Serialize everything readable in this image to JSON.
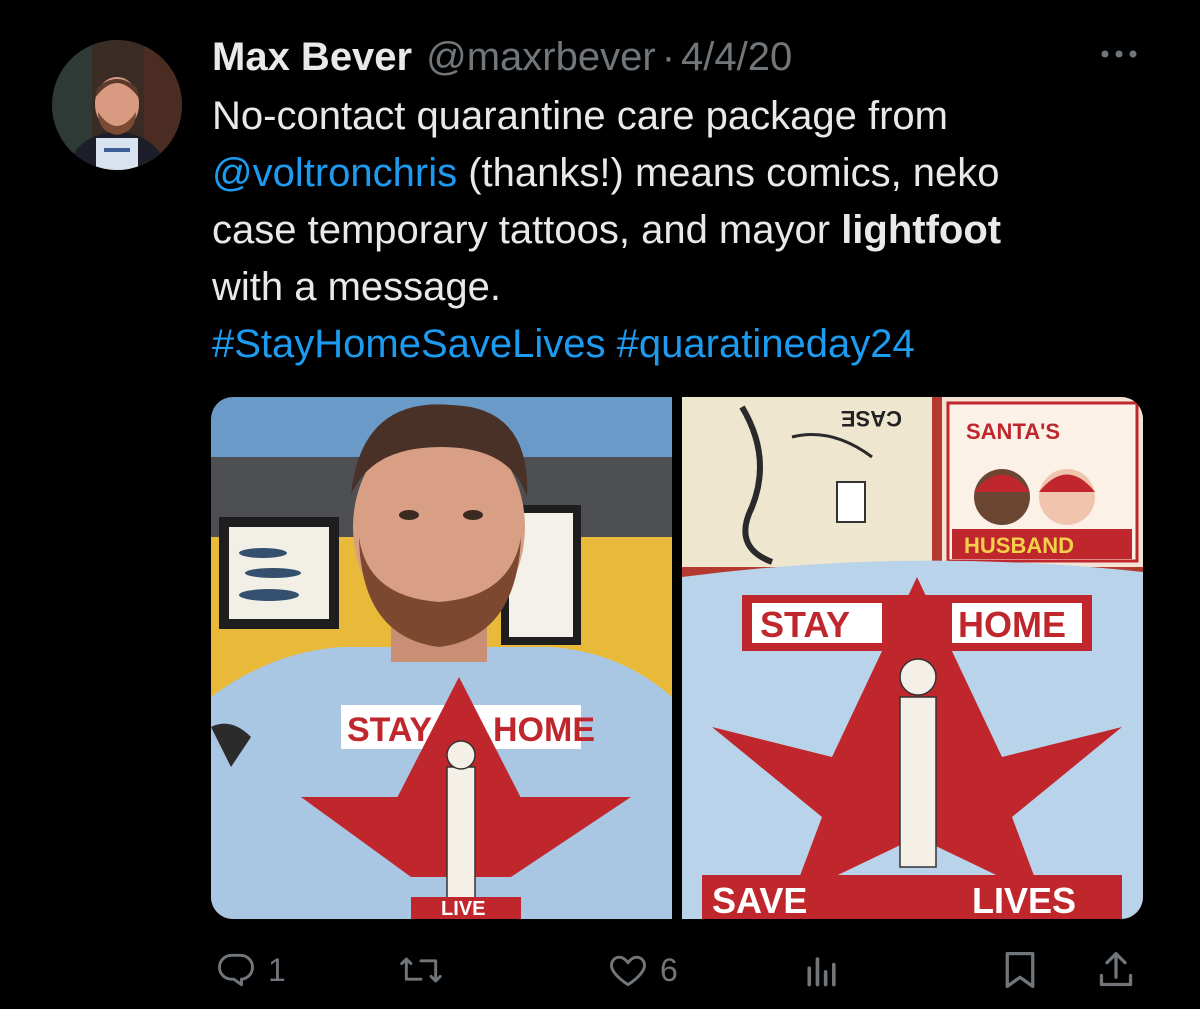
{
  "tweet": {
    "author_name": "Max Bever",
    "handle": "@maxrbever",
    "separator": "·",
    "date": "4/4/20",
    "text": {
      "line1": "No-contact quarantine care package from",
      "mention": "@voltronchris",
      "line2_rest": " (thanks!) means comics, neko",
      "line3_start": "case temporary tattoos, and mayor ",
      "line3_bold": "lightfoot",
      "line4": "with a message.",
      "hashtag1": "#StayHomeSaveLives",
      "hashtag2": "#quaratineday24"
    },
    "media": [
      {
        "shirt_text_top_left": "STAY",
        "shirt_text_top_right": "HOME",
        "shirt_text_bottom": "LIVE"
      },
      {
        "shirt_text_top_left": "STAY",
        "shirt_text_top_right": "HOME",
        "shirt_text_bottom_left": "SAVE",
        "shirt_text_bottom_right": "LIVES",
        "card_title_top": "SANTA'S",
        "card_title_bottom": "HUSBAND",
        "tattoo_sheet_text": "CASE"
      }
    ],
    "actions": {
      "reply_count": "1",
      "retweet_count": "",
      "like_count": "6"
    }
  },
  "colors": {
    "background": "#000000",
    "text_primary": "#e7e9ea",
    "text_secondary": "#71767b",
    "link": "#1d9bf0",
    "shirt_blue": "#a9c6e3",
    "shirt_red": "#c0272d"
  },
  "icons": [
    "more-icon",
    "reply-icon",
    "retweet-icon",
    "like-icon",
    "views-icon",
    "bookmark-icon",
    "share-icon"
  ]
}
